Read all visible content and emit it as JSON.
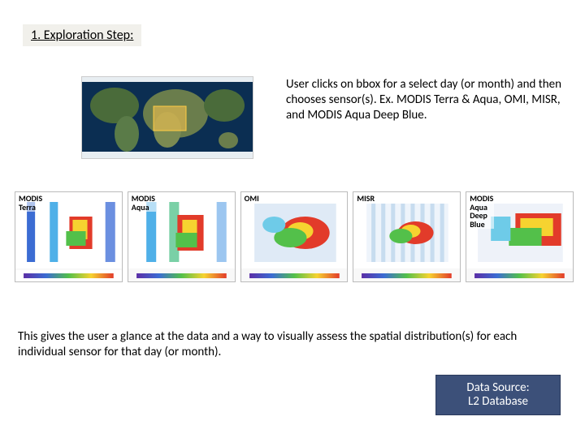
{
  "title": "1. Exploration Step:",
  "intro": "User clicks on bbox for a select day (or month) and then chooses sensor(s). Ex. MODIS Terra & Aqua, OMI, MISR, and MODIS Aqua Deep Blue.",
  "sensors": [
    {
      "label": "MODIS\nTerra"
    },
    {
      "label": "MODIS\nAqua"
    },
    {
      "label": "OMI"
    },
    {
      "label": "MISR"
    },
    {
      "label": "MODIS\nAqua\nDeep\nBlue"
    }
  ],
  "outro": "This gives the user a glance at the data and a way to visually assess the spatial distribution(s) for each individual sensor for that day (or month).",
  "badge_line1": "Data Source:",
  "badge_line2": "L2 Database"
}
